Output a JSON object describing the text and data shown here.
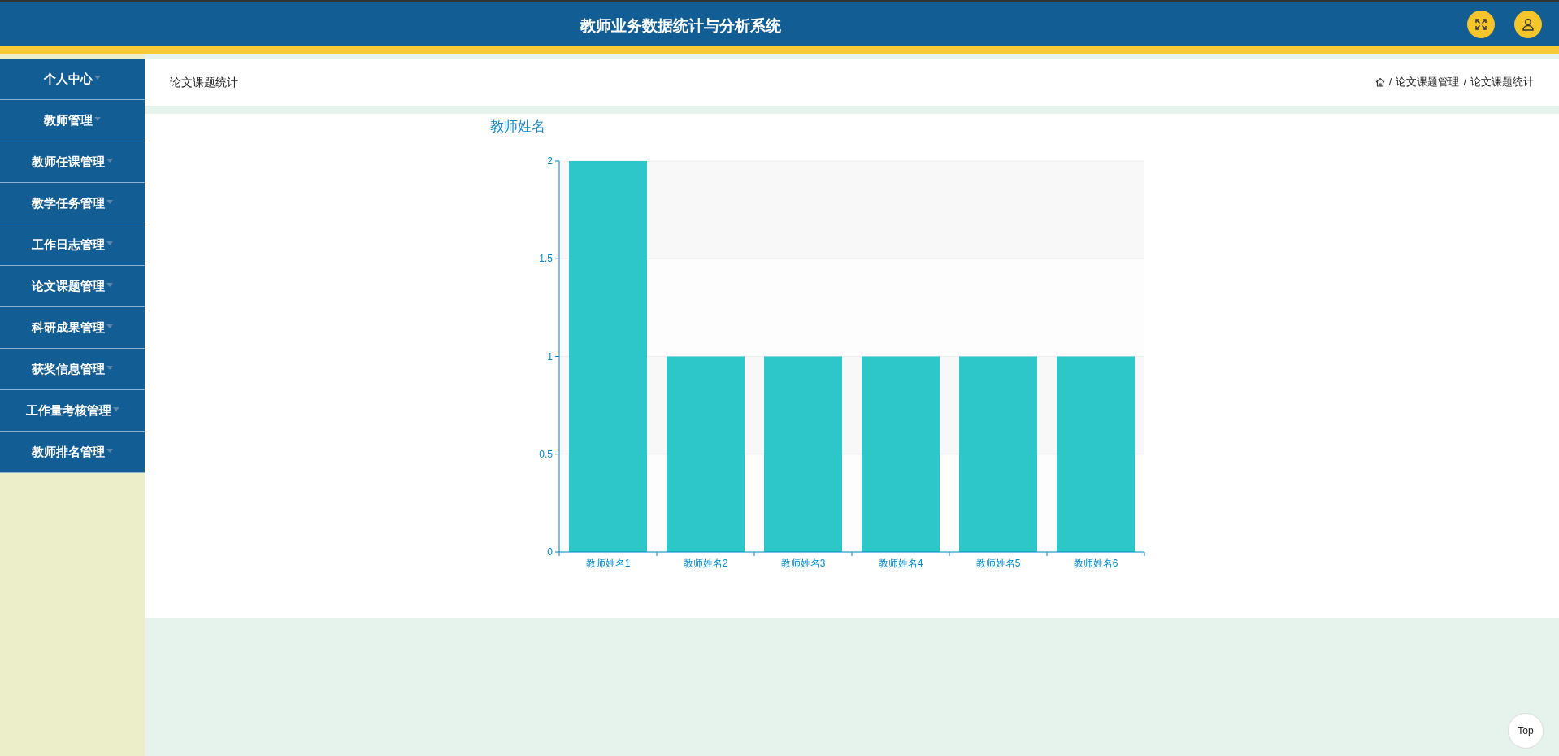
{
  "header": {
    "title": "教师业务数据统计与分析系统"
  },
  "sidebar": {
    "items": [
      {
        "label": "个人中心"
      },
      {
        "label": "教师管理"
      },
      {
        "label": "教师任课管理"
      },
      {
        "label": "教学任务管理"
      },
      {
        "label": "工作日志管理"
      },
      {
        "label": "论文课题管理"
      },
      {
        "label": "科研成果管理"
      },
      {
        "label": "获奖信息管理"
      },
      {
        "label": "工作量考核管理"
      },
      {
        "label": "教师排名管理"
      }
    ]
  },
  "page": {
    "title": "论文课题统计",
    "breadcrumb_separator": "/",
    "breadcrumb": [
      "论文课题管理",
      "论文课题统计"
    ]
  },
  "chart": {
    "chart_data": {
      "type": "bar",
      "title": "教师姓名",
      "categories": [
        "教师姓名1",
        "教师姓名2",
        "教师姓名3",
        "教师姓名4",
        "教师姓名5",
        "教师姓名6"
      ],
      "series": [
        {
          "color": "#2ec7c9",
          "values": [
            2,
            1,
            1,
            1,
            1,
            1
          ]
        }
      ],
      "ylim": [
        0,
        2
      ],
      "yticks": [
        0,
        0.5,
        1,
        1.5,
        2
      ],
      "grid": true
    }
  },
  "top_button": {
    "label": "Top"
  }
}
